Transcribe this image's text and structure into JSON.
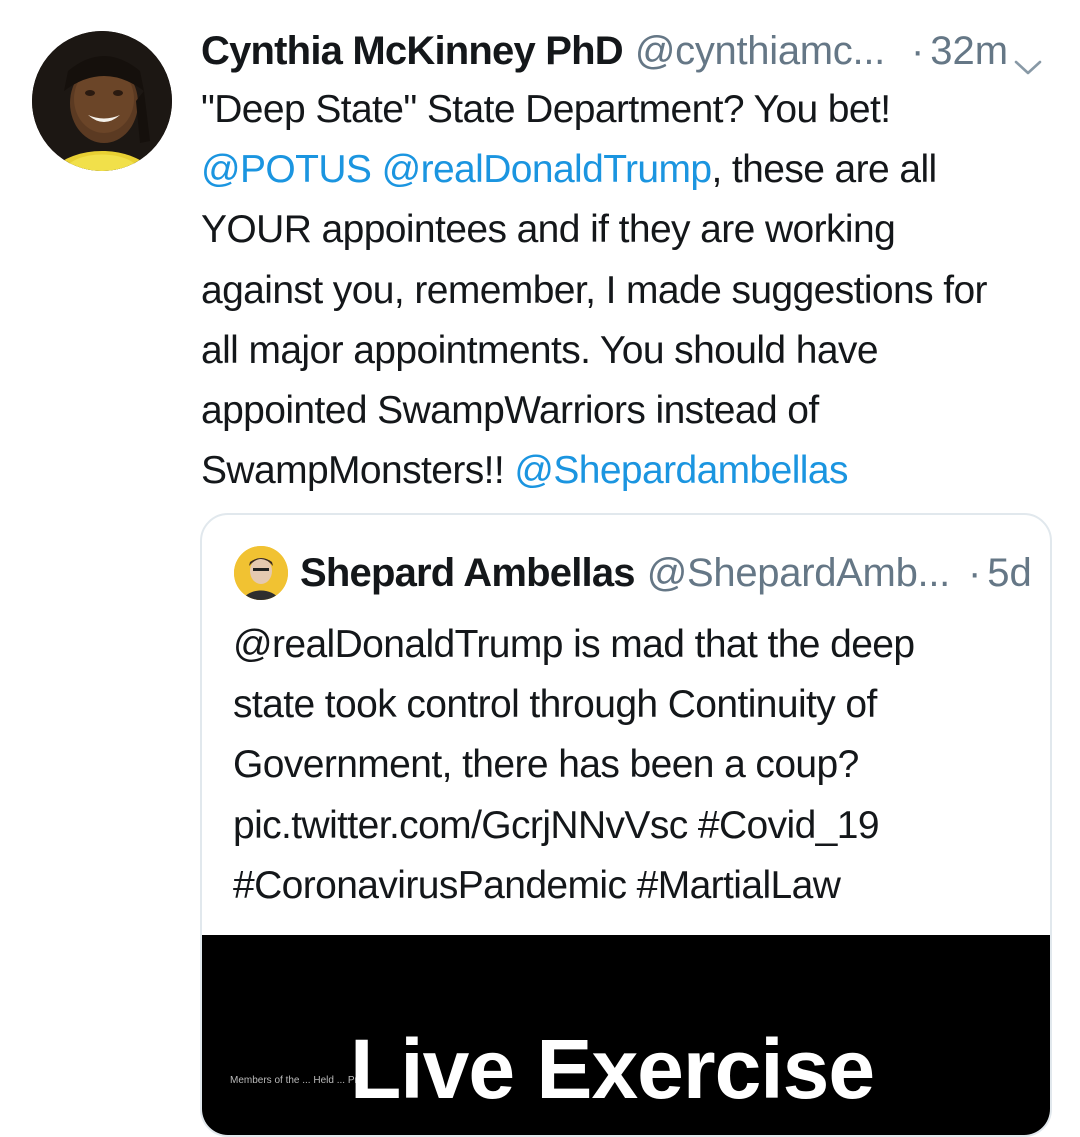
{
  "tweet": {
    "author_name": "Cynthia McKinney PhD",
    "author_handle": "@cynthiamc...",
    "dot": "·",
    "time": "32m",
    "menu_icon": "chevron-down-icon",
    "body_lines": [
      [
        {
          "t": "\"Deep State\" State Department? You bet!"
        }
      ],
      [
        {
          "t": "@POTUS",
          "m": true
        },
        {
          "t": " "
        },
        {
          "t": "@realDonaldTrump",
          "m": true
        },
        {
          "t": ", these are all"
        }
      ],
      [
        {
          "t": "YOUR appointees and if they are working"
        }
      ],
      [
        {
          "t": "against you, remember, I made suggestions for"
        }
      ],
      [
        {
          "t": "all major appointments. You should have"
        }
      ],
      [
        {
          "t": "appointed SwampWarriors instead of"
        }
      ],
      [
        {
          "t": "SwampMonsters!! "
        },
        {
          "t": "@Shepardambellas",
          "m": true
        }
      ]
    ]
  },
  "quoted_tweet": {
    "author_name": "Shepard Ambellas",
    "author_handle": "@ShepardAmb...",
    "dot": "·",
    "time": "5d",
    "body_lines": [
      [
        {
          "t": "@realDonaldTrump is mad that the deep"
        }
      ],
      [
        {
          "t": "state took control through Continuity of"
        }
      ],
      [
        {
          "t": "Government, there has been a coup?"
        }
      ],
      [
        {
          "t": "pic.twitter.com/GcrjNNvVsc #Covid_19"
        }
      ],
      [
        {
          "t": "#CoronavirusPandemic #MartialLaw"
        }
      ]
    ],
    "media": {
      "title": "Live Exercise",
      "caption": "Members of the ... Held ... Pri..."
    }
  },
  "colors": {
    "text": "#14171a",
    "secondary": "#657786",
    "link": "#1b95e0",
    "border": "#e1e8ed"
  }
}
